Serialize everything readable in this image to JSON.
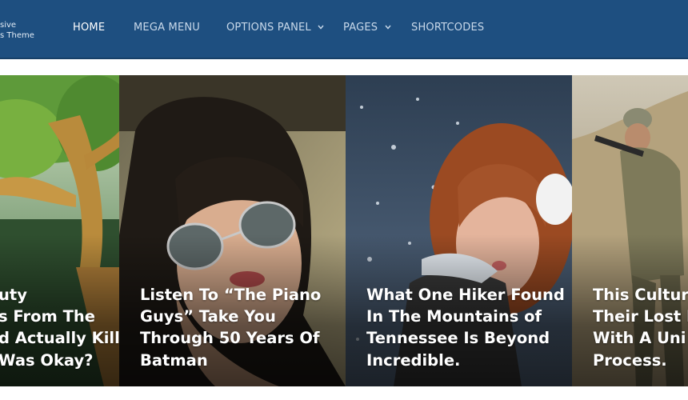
{
  "logo": {
    "line1": "sive",
    "line2": "s Theme"
  },
  "nav": [
    {
      "label": "HOME",
      "active": true
    },
    {
      "label": "MEGA MENU"
    },
    {
      "label": "OPTIONS PANEL",
      "dropdown": true
    },
    {
      "label": "PAGES",
      "dropdown": true
    },
    {
      "label": "SHORTCODES"
    }
  ],
  "colors": {
    "header_bg": "#1e4f80",
    "nav_active": "#ffffff",
    "nav_text": "#c9d9ea"
  },
  "slides": [
    {
      "image": "tree-forest",
      "title_lines": [
        "uty",
        "s From The",
        "d Actually Kill",
        "Was Okay?"
      ]
    },
    {
      "image": "woman-aviator-sunglasses",
      "title_lines": [
        "Listen To “The Piano",
        "Guys” Take You",
        "Through 50 Years Of",
        "Batman"
      ]
    },
    {
      "image": "woman-blowing-snow",
      "title_lines": [
        "What One Hiker Found",
        "In The Mountains of",
        "Tennessee Is Beyond",
        "Incredible."
      ]
    },
    {
      "image": "soldier-desert",
      "title_lines": [
        "This Cultur",
        "Their Lost I",
        "With A Uni",
        "Process."
      ]
    }
  ]
}
